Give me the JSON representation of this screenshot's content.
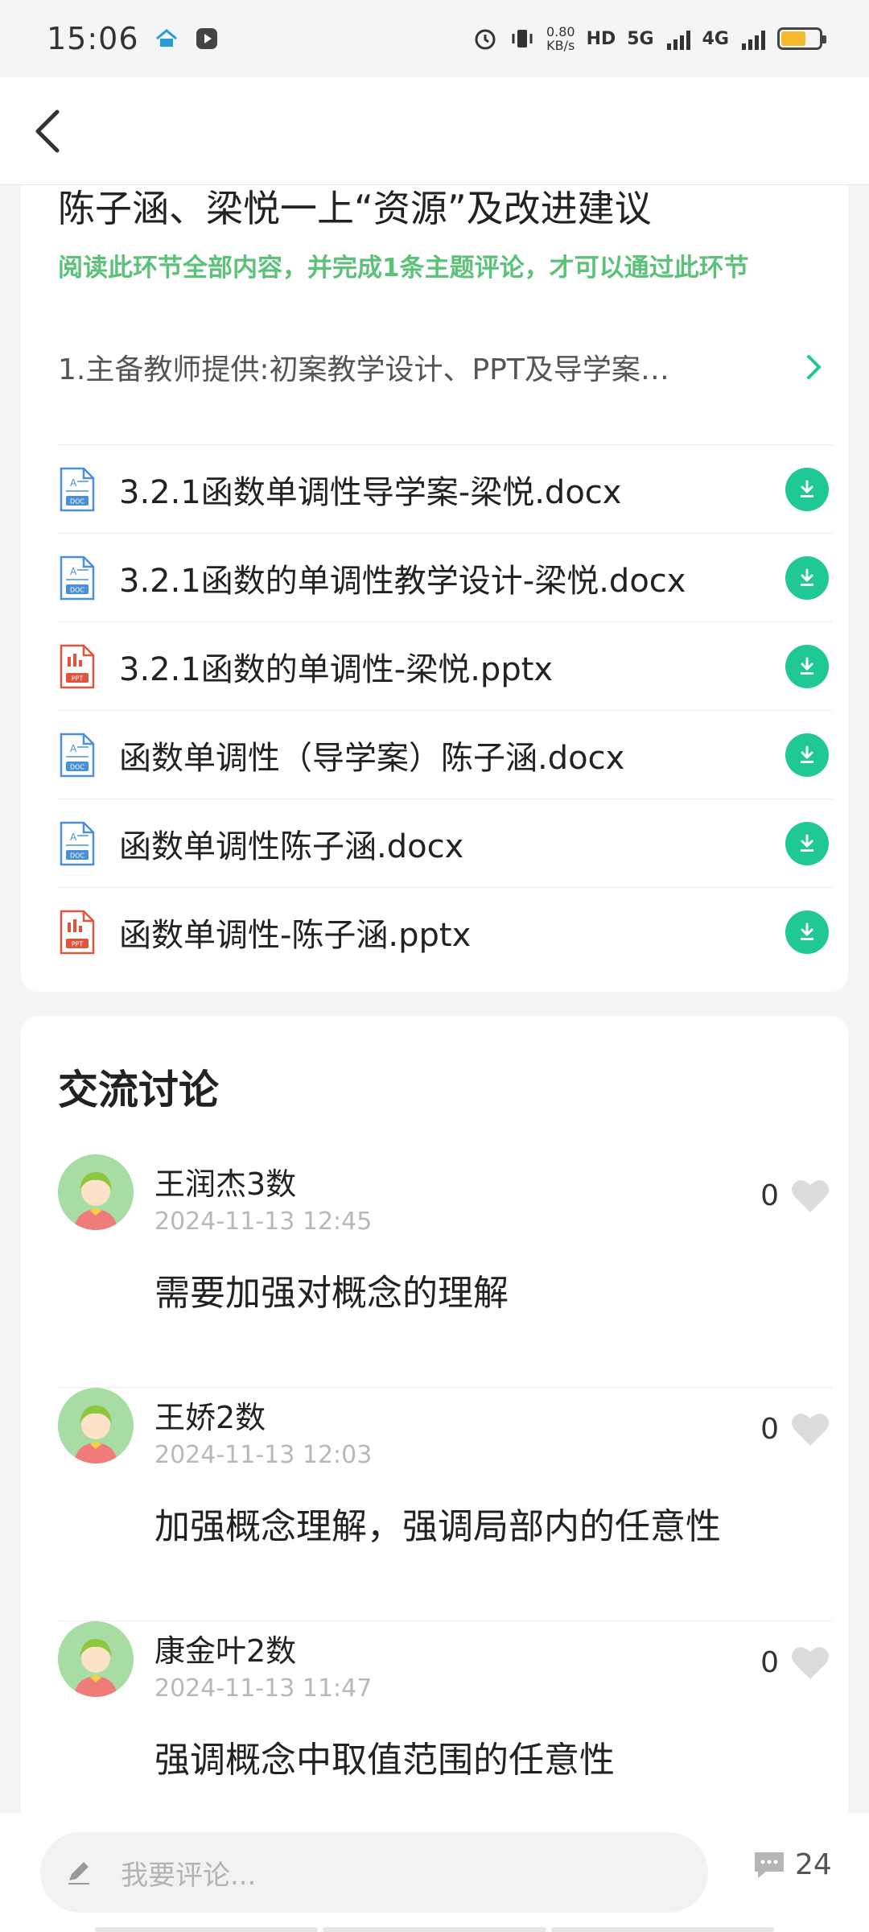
{
  "status_bar": {
    "time": "15:06",
    "net_speed_value": "0.80",
    "net_speed_unit": "KB/s",
    "hd_label": "HD",
    "net_5g": "5G",
    "net_4g": "4G",
    "battery_level": 0.65
  },
  "resource": {
    "title": "陈子涵、梁悦一上“资源”及改进建议",
    "requirement": "阅读此环节全部内容，并完成1条主题评论，才可以通过此环节",
    "description": "1.主备教师提供:初案教学设计、PPT及导学案…",
    "files": [
      {
        "name": "3.2.1函数单调性导学案-梁悦.docx",
        "type": "doc-icon"
      },
      {
        "name": "3.2.1函数的单调性教学设计-梁悦.docx",
        "type": "doc-icon"
      },
      {
        "name": "3.2.1函数的单调性-梁悦.pptx",
        "type": "ppt-icon"
      },
      {
        "name": "函数单调性（导学案）陈子涵.docx",
        "type": "doc-icon"
      },
      {
        "name": "函数单调性陈子涵.docx",
        "type": "doc-icon"
      },
      {
        "name": "函数单调性-陈子涵.pptx",
        "type": "ppt-icon"
      }
    ],
    "doc_badge": "DOC",
    "ppt_badge": "PPT"
  },
  "discussion": {
    "title": "交流讨论",
    "comments": [
      {
        "name": "王润杰3数",
        "time": "2024-11-13 12:45",
        "text": "需要加强对概念的理解",
        "likes": "0"
      },
      {
        "name": "王娇2数",
        "time": "2024-11-13 12:03",
        "text": "加强概念理解，强调局部内的任意性",
        "likes": "0"
      },
      {
        "name": "康金叶2数",
        "time": "2024-11-13 11:47",
        "text": "强调概念中取值范围的任意性",
        "likes": "0"
      }
    ]
  },
  "bottom_bar": {
    "placeholder": "我要评论...",
    "comment_count": "24"
  },
  "colors": {
    "accent_green": "#1fc895",
    "requirement_green": "#5cc27a",
    "doc_blue": "#4a90d9",
    "ppt_red": "#e0533d"
  }
}
